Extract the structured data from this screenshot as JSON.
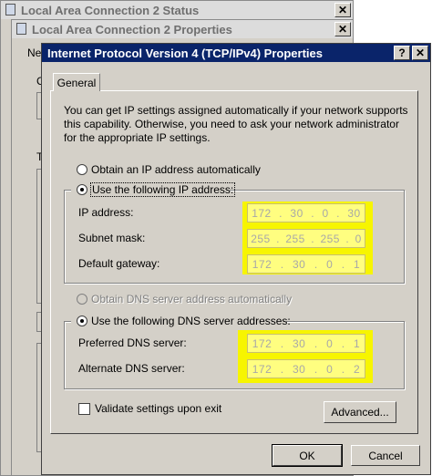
{
  "window1": {
    "title": "Local Area Connection 2 Status",
    "close": "✕"
  },
  "window2": {
    "title": "Local Area Connection 2 Properties",
    "close": "✕",
    "frag_ne": "Ne",
    "frag_c": "C",
    "frag_t": "T"
  },
  "dialog": {
    "title": "Internet Protocol Version 4 (TCP/IPv4) Properties",
    "help": "?",
    "close": "✕",
    "tab_general": "General",
    "description": "You can get IP settings assigned automatically if your network supports this capability. Otherwise, you need to ask your network administrator for the appropriate IP settings.",
    "radio_auto_ip": "Obtain an IP address automatically",
    "radio_manual_ip": "Use the following IP address:",
    "ip_address_label": "IP address:",
    "subnet_mask_label": "Subnet mask:",
    "default_gateway_label": "Default gateway:",
    "ip_address": [
      "172",
      "30",
      "0",
      "30"
    ],
    "subnet_mask": [
      "255",
      "255",
      "255",
      "0"
    ],
    "default_gateway": [
      "172",
      "30",
      "0",
      "1"
    ],
    "radio_auto_dns": "Obtain DNS server address automatically",
    "radio_manual_dns": "Use the following DNS server addresses:",
    "preferred_dns_label": "Preferred DNS server:",
    "alternate_dns_label": "Alternate DNS server:",
    "preferred_dns": [
      "172",
      "30",
      "0",
      "1"
    ],
    "alternate_dns": [
      "172",
      "30",
      "0",
      "2"
    ],
    "validate_label": "Validate settings upon exit",
    "advanced_button": "Advanced...",
    "ok_button": "OK",
    "cancel_button": "Cancel"
  },
  "colors": {
    "highlight": "#f7f500",
    "title_active": "#0a246a"
  }
}
